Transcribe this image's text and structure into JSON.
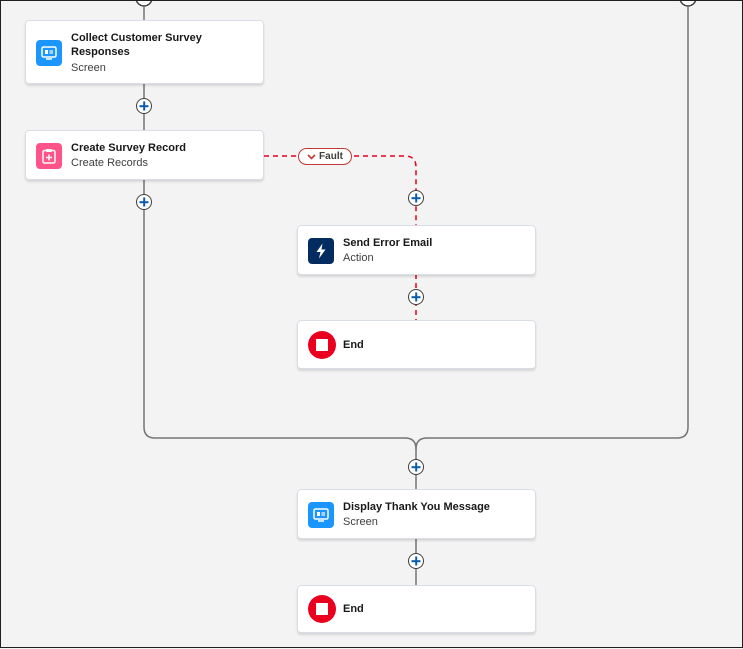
{
  "colors": {
    "screen_icon_bg": "#1b96ff",
    "create_icon_bg": "#ff538a",
    "action_icon_bg": "#032d60",
    "end_icon_bg": "#ea001e",
    "fault_line": "#ea001e",
    "connector": "#747474"
  },
  "nodes": {
    "collect": {
      "title": "Collect Customer Survey Responses",
      "subtitle": "Screen",
      "icon": "screen-icon"
    },
    "create": {
      "title": "Create Survey Record",
      "subtitle": "Create Records",
      "icon": "create-records-icon"
    },
    "send_error": {
      "title": "Send Error Email",
      "subtitle": "Action",
      "icon": "lightning-icon"
    },
    "end_fault": {
      "title": "End",
      "icon": "stop-icon"
    },
    "thank_you": {
      "title": "Display Thank You Message",
      "subtitle": "Screen",
      "icon": "screen-icon"
    },
    "end_final": {
      "title": "End",
      "icon": "stop-icon"
    }
  },
  "fault_badge": {
    "label": "Fault",
    "icon": "chevron-down-icon"
  }
}
